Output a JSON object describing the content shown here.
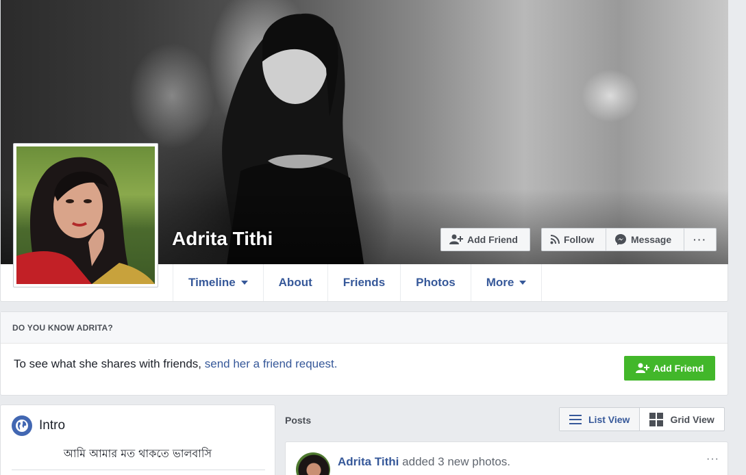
{
  "profile": {
    "name": "Adrita Tithi"
  },
  "cover_buttons": {
    "add_friend": "Add Friend",
    "follow": "Follow",
    "message": "Message",
    "more": "···"
  },
  "nav": {
    "tabs": [
      {
        "label": "Timeline",
        "has_caret": true
      },
      {
        "label": "About",
        "has_caret": false
      },
      {
        "label": "Friends",
        "has_caret": false
      },
      {
        "label": "Photos",
        "has_caret": false
      },
      {
        "label": "More",
        "has_caret": true
      }
    ]
  },
  "know_panel": {
    "heading": "DO YOU KNOW ADRITA?",
    "text": "To see what she shares with friends,",
    "link": "send her a friend request.",
    "button": "Add Friend"
  },
  "intro": {
    "title": "Intro",
    "bio": "আমি আমার মত থাকতে ভালবাসি"
  },
  "posts": {
    "label": "Posts",
    "list_view": "List View",
    "grid_view": "Grid View",
    "first_post": {
      "author": "Adrita Tithi",
      "action": "added 3 new photos.",
      "menu": "···"
    }
  },
  "colors": {
    "link": "#365899",
    "green_button": "#42b72a",
    "page_bg": "#e9ebee"
  }
}
